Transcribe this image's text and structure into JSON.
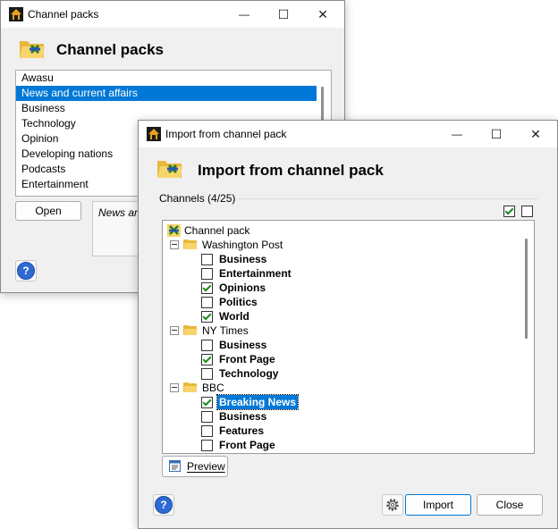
{
  "back_window": {
    "title": "Channel packs",
    "heading": "Channel packs",
    "list_items": [
      "Awasu",
      "News and current affairs",
      "Business",
      "Technology",
      "Opinion",
      "Developing nations",
      "Podcasts",
      "Entertainment"
    ],
    "selected_index": 1,
    "open_button": "Open",
    "description_text": "News and",
    "help_label": "?"
  },
  "dialog": {
    "title": "Import from channel pack",
    "heading": "Import from channel pack",
    "channels_label": "Channels (4/25)",
    "select_all_checked": true,
    "select_none_checked": false,
    "tree": {
      "root_label": "Channel pack",
      "groups": [
        {
          "label": "Washington Post",
          "items": [
            {
              "label": "Business",
              "checked": false
            },
            {
              "label": "Entertainment",
              "checked": false
            },
            {
              "label": "Opinions",
              "checked": true
            },
            {
              "label": "Politics",
              "checked": false
            },
            {
              "label": "World",
              "checked": true
            }
          ]
        },
        {
          "label": "NY Times",
          "items": [
            {
              "label": "Business",
              "checked": false
            },
            {
              "label": "Front Page",
              "checked": true
            },
            {
              "label": "Technology",
              "checked": false
            }
          ]
        },
        {
          "label": "BBC",
          "items": [
            {
              "label": "Breaking News",
              "checked": true,
              "highlighted": true
            },
            {
              "label": "Business",
              "checked": false
            },
            {
              "label": "Features",
              "checked": false
            },
            {
              "label": "Front Page",
              "checked": false
            }
          ]
        }
      ]
    },
    "preview_button": "Preview",
    "import_button": "Import",
    "close_button": "Close",
    "help_label": "?"
  },
  "titlebar_glyphs": {
    "minimize": "—",
    "maximize": "☐",
    "close": "✕"
  },
  "colors": {
    "selection": "#0078d7",
    "folder": "#e8b83c",
    "check": "#1d8a1d"
  }
}
